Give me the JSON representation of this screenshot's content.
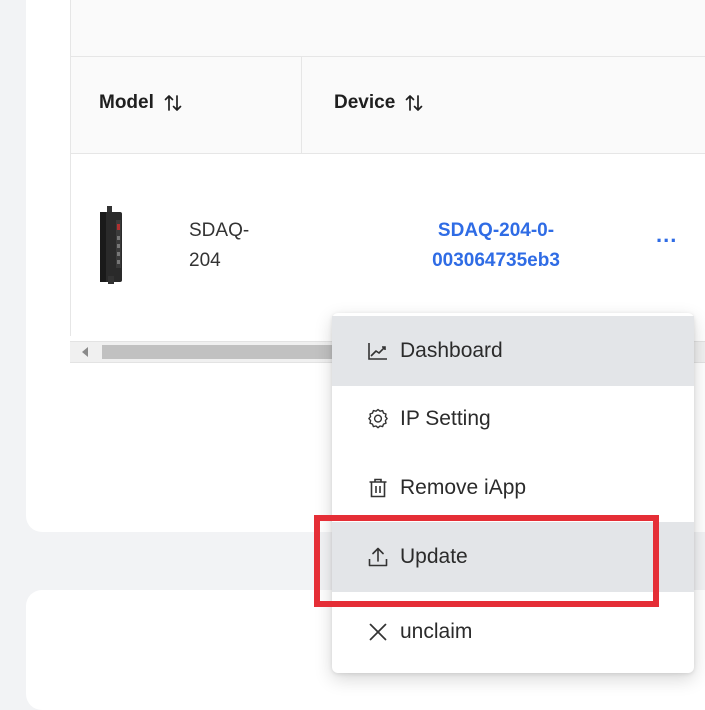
{
  "table": {
    "columns": [
      {
        "label": "Model",
        "sort_icon": "sort-arrows-icon"
      },
      {
        "label": "Device",
        "sort_icon": "sort-arrows-icon"
      }
    ],
    "rows": [
      {
        "model": "SDAQ-204",
        "model_line1": "SDAQ-",
        "model_line2": "204",
        "device_line1": "SDAQ-204-0-",
        "device_line2": "003064735eb3",
        "actions_label": "..."
      }
    ]
  },
  "context_menu": {
    "items": [
      {
        "label": "Dashboard",
        "icon": "chart-line-icon",
        "state": "hovered"
      },
      {
        "label": "IP Setting",
        "icon": "gear-icon",
        "state": "normal"
      },
      {
        "label": "Remove iApp",
        "icon": "trash-icon",
        "state": "normal"
      },
      {
        "label": "Update",
        "icon": "upload-icon",
        "state": "highlighted"
      },
      {
        "label": "unclaim",
        "icon": "close-icon",
        "state": "normal"
      }
    ]
  },
  "colors": {
    "link": "#2f6ce5",
    "highlight_border": "#e52e36",
    "hover_bg": "#e3e5e8",
    "page_bg": "#f2f3f5"
  }
}
